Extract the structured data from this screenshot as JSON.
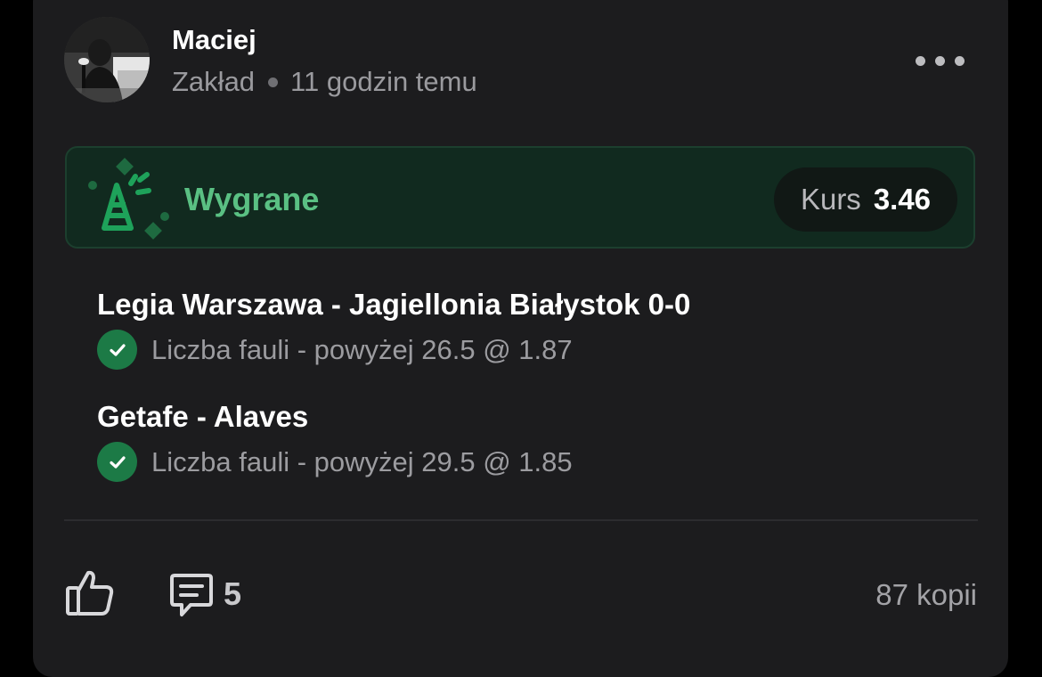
{
  "post": {
    "author": "Maciej",
    "type": "Zakład",
    "time": "11 godzin temu"
  },
  "result": {
    "status": "Wygrane",
    "odds_label": "Kurs",
    "odds_value": "3.46",
    "accent_color": "#5ac083"
  },
  "selections": [
    {
      "match": "Legia Warszawa - Jagiellonia Białystok 0-0",
      "bet": "Liczba fauli - powyżej 26.5 @ 1.87",
      "status_icon": "check-icon"
    },
    {
      "match": "Getafe - Alaves",
      "bet": "Liczba fauli - powyżej 29.5 @ 1.85",
      "status_icon": "check-icon"
    }
  ],
  "footer": {
    "comment_count": "5",
    "copies": "87 kopii"
  },
  "icons": {
    "more": "more-dots-icon",
    "celebration": "party-popper-icon",
    "like": "thumbs-up-icon",
    "comment": "comment-icon"
  }
}
